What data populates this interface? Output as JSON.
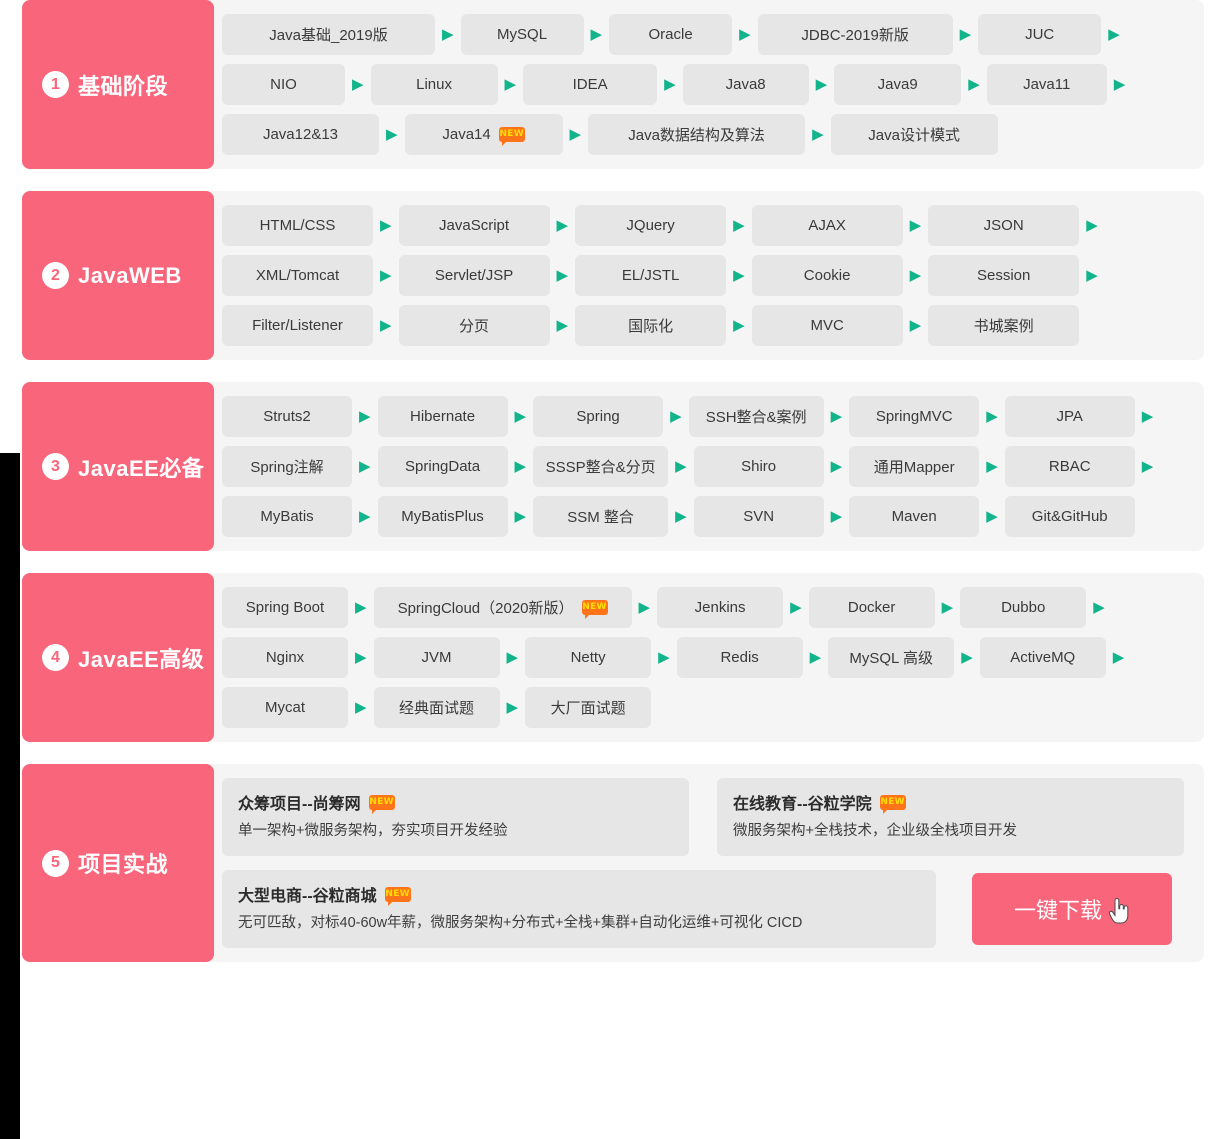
{
  "theme": {
    "accent": "#f9657a",
    "chip_bg": "#e6e6e6",
    "panel_bg": "#f5f5f5",
    "arrow_color": "#12b48b",
    "badge_bg": "#ff7418",
    "badge_text_color": "#ffe000"
  },
  "badge_label": "NEW",
  "stages": [
    {
      "number": "1",
      "title": "基础阶段",
      "rows": [
        [
          "Java基础_2019版",
          "MySQL",
          "Oracle",
          "JDBC-2019新版",
          "JUC"
        ],
        [
          "NIO",
          "Linux",
          "IDEA",
          "Java8",
          "Java9",
          "Java11"
        ],
        [
          "Java12&13",
          "Java14",
          "Java数据结构及算法",
          "Java设计模式"
        ]
      ]
    },
    {
      "number": "2",
      "title": "JavaWEB",
      "rows": [
        [
          "HTML/CSS",
          "JavaScript",
          "JQuery",
          "AJAX",
          "JSON"
        ],
        [
          "XML/Tomcat",
          "Servlet/JSP",
          "EL/JSTL",
          "Cookie",
          "Session"
        ],
        [
          "Filter/Listener",
          "分页",
          "国际化",
          "MVC",
          "书城案例"
        ]
      ]
    },
    {
      "number": "3",
      "title": "JavaEE必备",
      "rows": [
        [
          "Struts2",
          "Hibernate",
          "Spring",
          "SSH整合&案例",
          "SpringMVC",
          "JPA"
        ],
        [
          "Spring注解",
          "SpringData",
          "SSSP整合&分页",
          "Shiro",
          "通用Mapper",
          "RBAC"
        ],
        [
          "MyBatis",
          "MyBatisPlus",
          "SSM 整合",
          "SVN",
          "Maven",
          "Git&GitHub"
        ]
      ]
    },
    {
      "number": "4",
      "title": "JavaEE高级",
      "rows": [
        [
          "Spring Boot",
          "SpringCloud（2020新版）",
          "Jenkins",
          "Docker",
          "Dubbo"
        ],
        [
          "Nginx",
          "JVM",
          "Netty",
          "Redis",
          "MySQL 高级",
          "ActiveMQ"
        ],
        [
          "Mycat",
          "经典面试题",
          "大厂面试题"
        ]
      ]
    }
  ],
  "projects_stage": {
    "number": "5",
    "title": "项目实战",
    "cards": [
      {
        "title": "众筹项目--尚筹网",
        "desc": "单一架构+微服务架构，夯实项目开发经验",
        "new": true
      },
      {
        "title": "在线教育--谷粒学院",
        "desc": "微服务架构+全栈技术，企业级全栈项目开发",
        "new": true
      },
      {
        "title": "大型电商--谷粒商城",
        "desc": "无可匹敌，对标40-60w年薪，微服务架构+分布式+全栈+集群+自动化运维+可视化 CICD",
        "new": true
      }
    ],
    "download_label": "一键下载"
  }
}
